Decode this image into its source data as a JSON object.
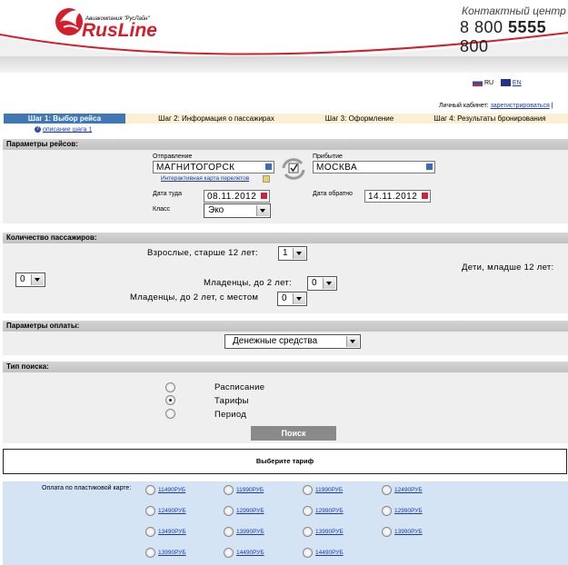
{
  "header": {
    "brand_name": "RusLine",
    "brand_sub": "Авиакомпания \"РусЛайн\"",
    "contact_title": "Контактный центр",
    "phone_prefix": "8 800 ",
    "phone_bold": "5555",
    "phone_suffix": " 800"
  },
  "lang": {
    "ru": "RU",
    "en": "EN"
  },
  "cabinet": {
    "label": "Личный кабинет:",
    "link": "зарегистрироваться",
    "sep": "|"
  },
  "steps": [
    {
      "label": "Шаг 1: Выбор рейса"
    },
    {
      "label": "Шаг 2: Информация о пассажирах"
    },
    {
      "label": "Шаг 3: Оформление"
    },
    {
      "label": "Шаг 4: Результаты бронирования"
    }
  ],
  "step_desc_link": "описание шага 1",
  "flight_params": {
    "title": "Параметры рейсов:",
    "from_label": "Отправление",
    "from_value": "МАГНИТОГОРСК",
    "map_link": "Интерактивная карта перелетов",
    "to_label": "Прибытие",
    "to_value": "МОСКВА",
    "date_from_label": "Дата туда",
    "date_from_value": "08.11.2012",
    "date_back_label": "Дата обратно",
    "date_back_value": "14.11.2012",
    "class_label": "Класс",
    "class_value": "Эко"
  },
  "passengers": {
    "title": "Количество пассажиров:",
    "adults_label": "Взрослые, старше 12 лет:",
    "adults_value": "1",
    "children_label": "Дети, младше 12 лет:",
    "children_value": "0",
    "infants_label": "Младенцы, до 2 лет:",
    "infants_value": "0",
    "infants_seat_label": "Младенцы, до 2 лет, с местом",
    "infants_seat_value": "0"
  },
  "payment": {
    "title": "Параметры оплаты:",
    "value": "Денежные средства"
  },
  "search_type": {
    "title": "Тип поиска:",
    "options": [
      {
        "label": "Расписание",
        "selected": false
      },
      {
        "label": "Тарифы",
        "selected": true
      },
      {
        "label": "Период",
        "selected": false
      }
    ],
    "button": "Поиск"
  },
  "tariff_box": {
    "title": "Выберите тариф"
  },
  "tariffs": {
    "card_label": "Оплата по пластиковой карте:",
    "rows": [
      [
        "11490РУБ",
        "11990РУБ",
        "11990РУБ",
        "12490РУБ"
      ],
      [
        "12490РУБ",
        "12990РУБ",
        "12990РУБ",
        "12990РУБ"
      ],
      [
        "13490РУБ",
        "13990РУБ",
        "13990РУБ",
        "13990РУБ"
      ],
      [
        "13990РУБ",
        "14490РУБ",
        "14490РУБ"
      ]
    ]
  },
  "colors": {
    "brand_red": "#d41f2b",
    "step_active": "#3f78b5",
    "step_inactive": "#fbf0d4",
    "tariff_bg": "#d4e4f4",
    "search_button": "#8a8a8a"
  }
}
